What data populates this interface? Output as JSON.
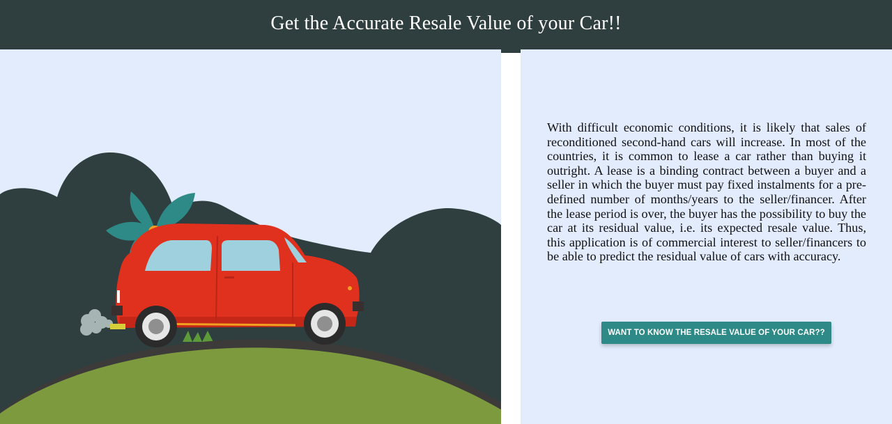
{
  "header": {
    "title": "Get the Accurate Resale Value of your Car!!"
  },
  "illustration": {
    "subject": "red-car-on-hill-icon"
  },
  "content": {
    "description": "With difficult economic conditions, it is likely that sales of reconditioned second-hand cars will increase. In most of the countries, it is common to lease a car rather than buying it outright. A lease is a binding contract between a buyer and a seller in which the buyer must pay fixed instalments for a pre-defined number of months/years to the seller/financer. After the lease period is over, the buyer has the possibility to buy the car at its residual value, i.e. its expected resale value. Thus, this application is of commercial interest to seller/financers to be able to predict the residual value of cars with accuracy.",
    "cta_label": "WANT TO KNOW THE RESALE VALUE OF YOUR CAR??"
  },
  "colors": {
    "header_bg": "#2f3e3e",
    "panel_bg": "#e3ecfd",
    "button_bg": "#2d8a86",
    "car_red": "#e0301e",
    "hill_green": "#7d9a3f",
    "bush_dark": "#2f3e3e"
  }
}
